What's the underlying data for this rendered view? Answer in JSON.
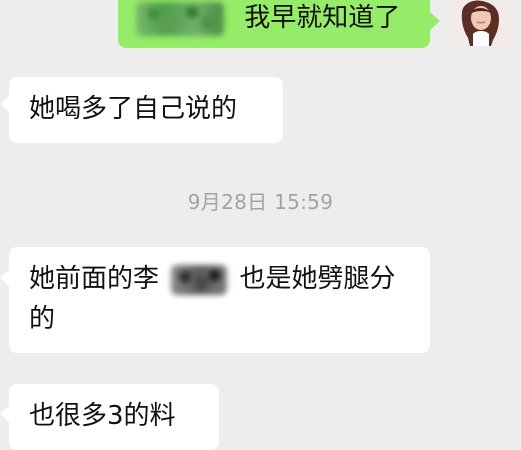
{
  "chat": {
    "messages": [
      {
        "direction": "out",
        "text": "我早就知道了"
      },
      {
        "direction": "in",
        "text": "她喝多了自己说的"
      },
      {
        "direction": "in",
        "text_before": "她前面的李",
        "text_after_line1": "也是她劈腿分",
        "text_line2": "的"
      },
      {
        "direction": "in",
        "text": "也很多3的料"
      }
    ],
    "timestamp": "9月28日 15:59"
  },
  "colors": {
    "background": "#ededed",
    "incoming_bubble": "#ffffff",
    "outgoing_bubble": "#95ec69",
    "timestamp_text": "#a3a3a3",
    "message_text": "#111111"
  },
  "icons": {
    "avatar": "user-avatar-icon",
    "blurred_content": "blurred-content"
  }
}
